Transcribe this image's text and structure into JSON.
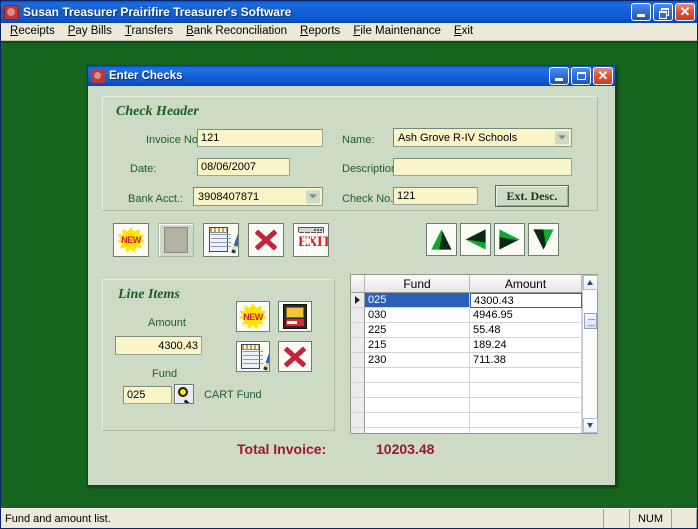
{
  "app": {
    "title": "Susan Treasurer Prairifire Treasurer's Software",
    "icon": "app-icon",
    "window_buttons": {
      "minimize": "minimize-icon",
      "restore": "restore-icon",
      "close": "close-icon"
    }
  },
  "menubar": {
    "items": [
      {
        "label": "Receipts",
        "accel": "R"
      },
      {
        "label": "Pay Bills",
        "accel": "P"
      },
      {
        "label": "Transfers",
        "accel": "T"
      },
      {
        "label": "Bank Reconciliation",
        "accel": "B"
      },
      {
        "label": "Reports",
        "accel": "R"
      },
      {
        "label": "File Maintenance",
        "accel": "F"
      },
      {
        "label": "Exit",
        "accel": "E"
      }
    ]
  },
  "child_window": {
    "title": "Enter Checks",
    "window_buttons": {
      "minimize": "minimize-icon",
      "maximize": "maximize-icon",
      "close": "close-icon"
    }
  },
  "check_header": {
    "title": "Check Header",
    "invoice_no": {
      "label": "Invoice No.:",
      "value": "121"
    },
    "date": {
      "label": "Date:",
      "value": "08/06/2007"
    },
    "bank_acct": {
      "label": "Bank Acct.:",
      "value": "3908407871"
    },
    "name": {
      "label": "Name:",
      "value": "Ash Grove R-IV Schools"
    },
    "description": {
      "label": "Description:",
      "value": ""
    },
    "check_no": {
      "label": "Check No.:",
      "value": "121"
    },
    "ext_desc_button": "Ext. Desc."
  },
  "header_toolbar": {
    "buttons": [
      {
        "name": "new-check-button",
        "icon": "new-starburst-icon",
        "label": "NEW"
      },
      {
        "name": "blank-card-button",
        "icon": "blank-card-icon",
        "label": ""
      },
      {
        "name": "edit-check-button",
        "icon": "edit-notepad-icon",
        "label": ""
      },
      {
        "name": "delete-check-button",
        "icon": "red-x-icon",
        "label": ""
      },
      {
        "name": "exit-button",
        "icon": "exit-door-icon",
        "label": "EXIT"
      }
    ]
  },
  "nav_toolbar": {
    "buttons": [
      {
        "name": "nav-first-button",
        "icon": "triangle-up-icon"
      },
      {
        "name": "nav-prev-button",
        "icon": "triangle-left-icon"
      },
      {
        "name": "nav-next-button",
        "icon": "triangle-right-icon"
      },
      {
        "name": "nav-last-button",
        "icon": "triangle-down-icon"
      }
    ]
  },
  "line_items": {
    "title": "Line Items",
    "amount": {
      "label": "Amount",
      "value": "4300.43"
    },
    "fund": {
      "label": "Fund",
      "value": "025",
      "lookup_icon": "magnifier-icon",
      "description": "CART Fund"
    },
    "buttons": [
      {
        "name": "new-line-item-button",
        "icon": "new-starburst-icon",
        "label": "NEW"
      },
      {
        "name": "save-line-item-button",
        "icon": "floppy-save-icon",
        "label": ""
      },
      {
        "name": "edit-line-item-button",
        "icon": "edit-notepad-icon",
        "label": ""
      },
      {
        "name": "delete-line-item-button",
        "icon": "red-x-icon",
        "label": ""
      }
    ]
  },
  "grid": {
    "columns": [
      "Fund",
      "Amount"
    ],
    "rows": [
      {
        "fund": "025",
        "amount": "4300.43",
        "selected": true
      },
      {
        "fund": "030",
        "amount": "4946.95",
        "selected": false
      },
      {
        "fund": "225",
        "amount": "55.48",
        "selected": false
      },
      {
        "fund": "215",
        "amount": "189.24",
        "selected": false
      },
      {
        "fund": "230",
        "amount": "711.38",
        "selected": false
      },
      {
        "fund": "",
        "amount": "",
        "selected": false
      },
      {
        "fund": "",
        "amount": "",
        "selected": false
      },
      {
        "fund": "",
        "amount": "",
        "selected": false
      },
      {
        "fund": "",
        "amount": "",
        "selected": false
      },
      {
        "fund": "",
        "amount": "",
        "selected": false
      }
    ],
    "scrollbar": {
      "up_icon": "scroll-up-icon",
      "down_icon": "scroll-down-icon",
      "thumb": "scroll-thumb"
    }
  },
  "total": {
    "label": "Total Invoice:",
    "value": "10203.48"
  },
  "statusbar": {
    "message": "Fund and amount list.",
    "num_indicator": "NUM"
  },
  "colors": {
    "mdi_background": "#17641f",
    "dialog_background": "#cddbc6",
    "titlebar_blue": "#1360d8",
    "field_yellow": "#f9f5c8",
    "label_green": "#1d5c2c",
    "total_red": "#9c1436",
    "grid_selection": "#2a5fba"
  }
}
